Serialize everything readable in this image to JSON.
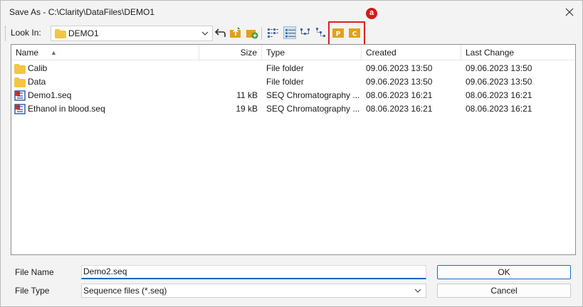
{
  "window": {
    "title": "Save As - C:\\Clarity\\DataFiles\\DEMO1"
  },
  "toolbar": {
    "look_in_label": "Look In:",
    "look_in_value": "DEMO1",
    "buttons": [
      {
        "name": "up-one-level",
        "icon": "back-arrow-icon"
      },
      {
        "name": "go-to-project",
        "icon": "folder-up-icon"
      },
      {
        "name": "new-folder",
        "icon": "new-folder-icon"
      },
      {
        "name": "view-list",
        "icon": "list-view-icon"
      },
      {
        "name": "view-details",
        "icon": "details-view-icon"
      },
      {
        "name": "view-tree",
        "icon": "tree-view-icon"
      },
      {
        "name": "view-tree-alt",
        "icon": "tree-view-alt-icon"
      },
      {
        "name": "project-folder",
        "icon": "project-folder-icon",
        "letter": "P"
      },
      {
        "name": "common-folder",
        "icon": "common-folder-icon",
        "letter": "C"
      }
    ],
    "marker_label": "a",
    "highlight_color": "#e02020"
  },
  "filelist": {
    "columns": [
      "Name",
      "Size",
      "Type",
      "Created",
      "Last Change"
    ],
    "rows": [
      {
        "name": "Calib",
        "size": "",
        "type": "File folder",
        "created": "09.06.2023 13:50",
        "changed": "09.06.2023 13:50",
        "icon": "folder-icon"
      },
      {
        "name": "Data",
        "size": "",
        "type": "File folder",
        "created": "09.06.2023 13:50",
        "changed": "09.06.2023 13:50",
        "icon": "folder-icon"
      },
      {
        "name": "Demo1.seq",
        "size": "11 kB",
        "type": "SEQ Chromatography ...",
        "created": "08.06.2023 16:21",
        "changed": "08.06.2023 16:21",
        "icon": "sequence-file-icon"
      },
      {
        "name": "Ethanol in blood.seq",
        "size": "19 kB",
        "type": "SEQ Chromatography ...",
        "created": "08.06.2023 16:21",
        "changed": "08.06.2023 16:21",
        "icon": "sequence-file-icon"
      }
    ]
  },
  "form": {
    "file_name_label": "File Name",
    "file_name_value": "Demo2.seq",
    "file_type_label": "File Type",
    "file_type_value": "Sequence files (*.seq)"
  },
  "buttons": {
    "ok": "OK",
    "cancel": "Cancel"
  },
  "colors": {
    "folder": "#f4c542",
    "accent": "#1a6dd6",
    "toolbar_folder": "#e0a21a"
  }
}
